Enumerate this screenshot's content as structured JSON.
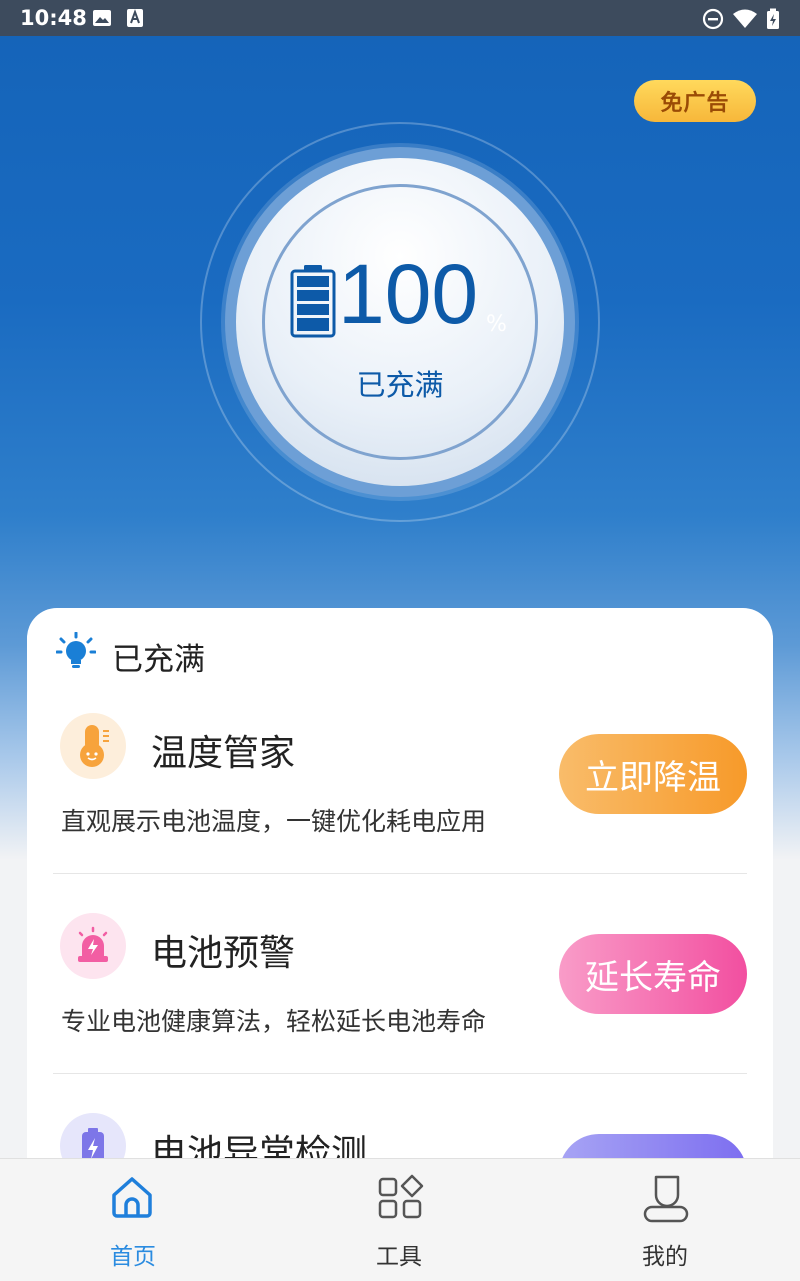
{
  "status_bar": {
    "time": "10:48"
  },
  "header": {
    "ad_free_label": "免广告"
  },
  "gauge": {
    "percent": "100",
    "percent_sign": "%",
    "status": "已充满"
  },
  "card": {
    "status_text": "已充满",
    "features": [
      {
        "title": "温度管家",
        "description": "直观展示电池温度，一键优化耗电应用",
        "button": "立即降温",
        "icon": "thermometer-icon"
      },
      {
        "title": "电池预警",
        "description": "专业电池健康算法，轻松延长电池寿命",
        "button": "延长寿命",
        "icon": "alarm-icon"
      },
      {
        "title": "电池异常检测",
        "description": "",
        "button": "",
        "icon": "battery-bolt-icon"
      }
    ]
  },
  "tabbar": {
    "tabs": [
      {
        "label": "首页",
        "icon": "home-icon",
        "active": true
      },
      {
        "label": "工具",
        "icon": "grid-icon",
        "active": false
      },
      {
        "label": "我的",
        "icon": "profile-icon",
        "active": false
      }
    ]
  },
  "colors": {
    "primary_blue": "#0d5aa8",
    "tab_active": "#2a8be0",
    "orange_button": "#f7a13a",
    "pink_button": "#f561a9",
    "purple_button": "#8a7df0",
    "ad_pill": "#f7b73a"
  }
}
